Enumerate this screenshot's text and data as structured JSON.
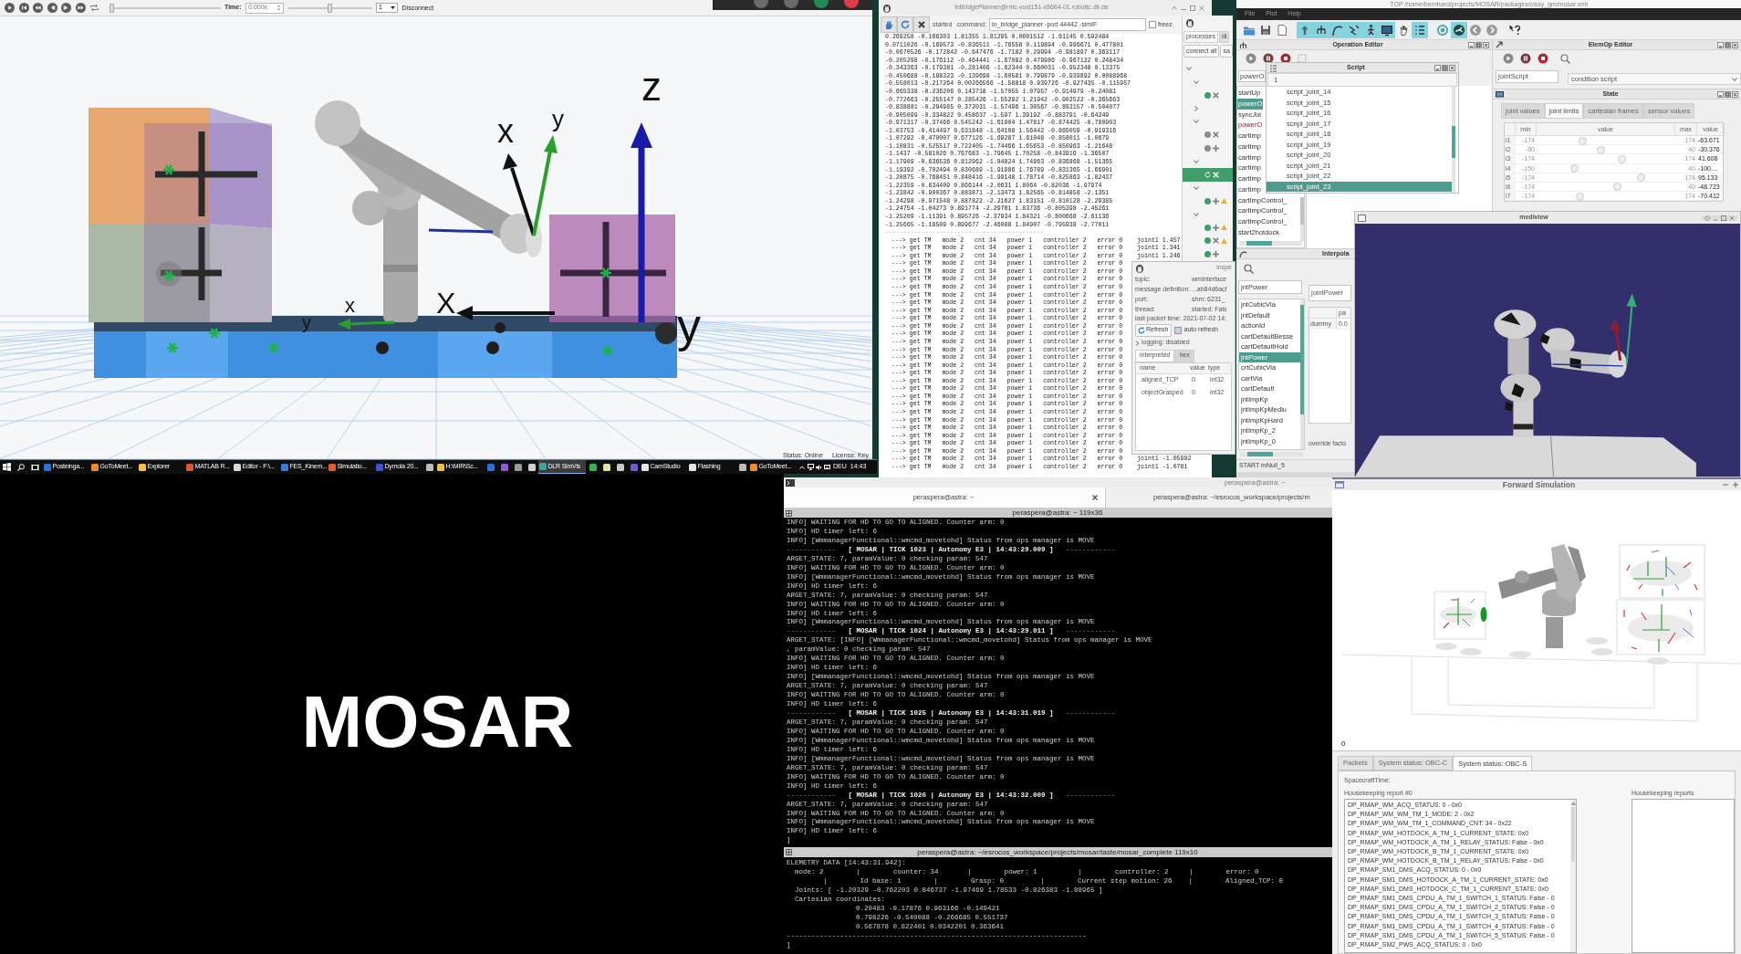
{
  "simvis": {
    "toolbar": {
      "position_slider": {
        "level": 0
      },
      "time_label": "Time:",
      "time_value": "0,000x",
      "rate_slider": {
        "level": 0.5
      },
      "speed": "1",
      "disconnect": "Disconnect"
    },
    "axis_labels": [
      "z",
      "y",
      "X",
      "x",
      "y",
      "x",
      "y"
    ],
    "status": "Status: Online",
    "license": "License: Key"
  },
  "taskbar": {
    "items": [
      {
        "label": "Posteinga...",
        "color": "#2b72d6",
        "selected": false
      },
      {
        "label": "GoToMeet...",
        "color": "#f08a24",
        "selected": false
      },
      {
        "label": "Explorer",
        "color": "#f2c23c",
        "selected": false
      },
      {
        "label": "MATLAB R...",
        "color": "#e0562a",
        "selected": false
      },
      {
        "label": "Editor - F:\\...",
        "color": "#d9d9d9",
        "selected": false
      },
      {
        "label": "FES_Kinem...",
        "color": "#3a7bd5",
        "selected": false
      },
      {
        "label": "Simulatio...",
        "color": "#e35d2b",
        "selected": false
      },
      {
        "label": "Dymola 20...",
        "color": "#3656d6",
        "selected": false
      },
      {
        "color": "#bdbdbd",
        "selected": false
      },
      {
        "label": "H:\\MIR\\Sc...",
        "color": "#f2c23c",
        "selected": false
      },
      {
        "color": "#2e6fd8",
        "selected": false
      },
      {
        "color": "#8b5bd8",
        "selected": false
      },
      {
        "color": "#9a9a9a",
        "selected": false
      },
      {
        "color": "#d0d0d0",
        "selected": false
      },
      {
        "label": "DLR SimVis",
        "color": "#39a3a0",
        "selected": true
      },
      {
        "color": "#36b24a",
        "selected": false
      },
      {
        "color": "#e3e3a5",
        "selected": false
      },
      {
        "color": "#c8c8c8",
        "selected": false
      },
      {
        "color": "#6c5bd6",
        "selected": false
      },
      {
        "label": "CamStudio",
        "color": "#e6e6e6",
        "selected": false
      },
      {
        "label": "Flashing",
        "color": "#e6e6e6",
        "selected": false
      },
      {
        "color": "#bcbcbc",
        "selected": false
      },
      {
        "label": "GoToMeet...",
        "color": "#f08a24",
        "selected": false
      }
    ],
    "language": "DEU",
    "clock": "14:43"
  },
  "title_card": {
    "text": "MOSAR"
  },
  "planner": {
    "title": "lnBridgePlanner@rmc-vosl151-x8664-01.robotic.dlr.de",
    "state": "started",
    "command_label": "command:",
    "command": "ln_bridge_planner -port 44442 -simIF",
    "freeze": {
      "label": "freez",
      "checked": false
    },
    "output": [
      "0.269258 -0.166303 1.81355 1.81295 0.0601512 -1.61145 0.592484",
      "0.0711026 -0.169573 -0.836511 -1.76558 0.119894 -0.996671 0.477801",
      "-0.0670526 -0.172842 -0.647476 -1.7182 0.29994 -0.981897 0.363117",
      "-0.205298 -0.176112 -0.464441 -1.67082 0.479986 -0.967122 0.248434",
      "-0.343363 -0.179381 -0.281406 -1.62344 0.660031 -0.952348 0.13375",
      "-0.450688 -0.198323 -0.139698 -1.60581 0.799879 -0.939892 0.0088968",
      "-0.558013 -0.217264 0.00266566 -1.58818 0.939726 -0.927435 -0.115957",
      "-0.665338 -0.236206 0.143718 -1.57055 1.07957 -0.914979 -0.24081",
      "-0.772663 -0.255147 0.285426 -1.55292 1.21942 -0.902522 -0.365663",
      "-0.838881 -0.294985 0.372031 -1.57496 1.30567 -0.893157 -0.504077",
      "-0.905099 -0.334822 0.458637 -1.597 1.39192 -0.883791 -0.64249",
      "-0.971317 -0.37466 0.545242 -1.61904 1.47817 -0.874425 -0.780903",
      "-1.03753 -0.414497 0.631848 -1.64108 1.56442 -0.865059 -0.919316",
      "-1.07292 -0.470007 0.677126 -1.69287 1.61048 -0.858011 -1.0679",
      "-1.10831 -0.525517 0.722405 -1.74466 1.65653 -0.850963 -1.21648",
      "-1.1437 -0.581026 0.767683 -1.79645 1.70258 -0.843916 -1.36507",
      "-1.17909 -0.636536 0.812962 -1.84824 1.74863 -0.836868 -1.51365",
      "-1.19392 -0.702494 0.830689 -1.91986 1.76789 -0.831365 -1.66901",
      "-1.20875 -0.768451 0.848416 -1.99148 1.78714 -0.825863 -1.82437",
      "-1.22359 -0.834409 0.866144 -2.0631 1.8064 -0.82036 -1.97974",
      "-1.23842 -0.900367 0.883871 -2.13473 1.82565 -0.814858 -2.1351",
      "-1.24298 -0.971548 0.887822 -2.21627 1.83151 -0.810128 -2.29385",
      "-1.24754 -1.04273 0.891774 -2.29781 1.83736 -0.805398 -2.45261",
      "-1.25209 -1.11391 0.895726 -2.37934 1.84321 -0.800668 -2.61136",
      "-1.25665 -1.18509 0.899677 -2.46088 1.84907 -0.795938 -2.77011"
    ],
    "separator": "--------------------------------------------",
    "get_tm_rows": [
      "---> get TM   mode 2   cnt 34   power 1   controller 2   error 0    joint1 1.457",
      "---> get TM   mode 2   cnt 34   power 1   controller 2   error 0    joint1 1.341",
      "---> get TM   mode 2   cnt 34   power 1   controller 2   error 0    joint1 1.246",
      "---> get TM   mode 2   cnt 34   power 1   controller 2   error 0",
      "---> get TM   mode 2   cnt 34   power 1   controller 2   error 0",
      "---> get TM   mode 2   cnt 34   power 1   controller 2   error 0",
      "---> get TM   mode 2   cnt 34   power 1   controller 2   error 0",
      "---> get TM   mode 2   cnt 34   power 1   controller 2   error 0",
      "---> get TM   mode 2   cnt 34   power 1   controller 2   error 0",
      "---> get TM   mode 2   cnt 34   power 1   controller 2   error 0",
      "---> get TM   mode 2   cnt 34   power 1   controller 2   error 0",
      "---> get TM   mode 2   cnt 34   power 1   controller 2   error 0",
      "---> get TM   mode 2   cnt 34   power 1   controller 2   error 0",
      "---> get TM   mode 2   cnt 34   power 1   controller 2   error 0",
      "---> get TM   mode 2   cnt 34   power 1   controller 2   error 0",
      "---> get TM   mode 2   cnt 34   power 1   controller 2   error 0",
      "---> get TM   mode 2   cnt 34   power 1   controller 2   error 0",
      "---> get TM   mode 2   cnt 34   power 1   controller 2   error 0",
      "---> get TM   mode 2   cnt 34   power 1   controller 2   error 0",
      "---> get TM   mode 2   cnt 34   power 1   controller 2   error 0",
      "---> get TM   mode 2   cnt 34   power 1   controller 2   error 0",
      "---> get TM   mode 2   cnt 34   power 1   controller 2   error 0",
      "---> get TM   mode 2   cnt 34   power 1   controller 2   error 0",
      "---> get TM   mode 2   cnt 34   power 1   controller 2   error 0",
      "---> get TM   mode 2   cnt 34   power 1   controller 2   error 0",
      "---> get TM   mode 2   cnt 34   power 1   controller 2   error 0",
      "---> get TM   mode 2   cnt 34   power 1   controller 2   error 0",
      "---> get TM   mode 2   cnt 34   power 1   controller 2   error 0",
      "---> get TM   mode 2   cnt 34   power 1   controller 2   error 0    joint1 -1.05992",
      "---> get TM   mode 2   cnt 34   power 1   controller 2   error 0    joint1 -1.0781"
    ],
    "processes": {
      "tabs": [
        {
          "label": "processes",
          "selected": true
        },
        {
          "label": "di",
          "selected": false
        }
      ],
      "buttons": [
        "connect all",
        "sa"
      ],
      "tree": [
        {
          "expanded": true,
          "selected": false,
          "children": [
            {
              "expanded": true,
              "selected": false,
              "children": [
                {
                  "kind": "cross",
                  "color": "#3f9d6b",
                  "warning": false,
                  "selected": false
                }
              ]
            },
            {
              "expanded": false,
              "selected": false
            },
            {
              "expanded": true,
              "selected": false,
              "children": [
                {
                  "kind": "cross",
                  "color": "#8c8c8c",
                  "warning": false,
                  "selected": false
                },
                {
                  "kind": "plus",
                  "color": "#8c8c8c",
                  "warning": false,
                  "selected": false
                }
              ]
            },
            {
              "expanded": true,
              "selected": false,
              "children": [
                {
                  "kind": "busy",
                  "warning": false,
                  "selected": true
                }
              ]
            },
            {
              "expanded": true,
              "selected": false,
              "children": [
                {
                  "kind": "plus",
                  "color": "#3f9d6b",
                  "warning": true,
                  "selected": false
                }
              ]
            },
            {
              "expanded": true,
              "selected": false,
              "children": [
                {
                  "kind": "plus",
                  "color": "#3f9d6b",
                  "warning": true,
                  "selected": false
                },
                {
                  "kind": "cross",
                  "color": "#3f9d6b",
                  "warning": true,
                  "selected": false
                },
                {
                  "kind": "plus",
                  "color": "#3f9d6b",
                  "warning": false,
                  "selected": false
                }
              ]
            }
          ]
        }
      ]
    },
    "inspector": {
      "title": "inspe",
      "fields": [
        {
          "label": "topic:",
          "value": "wmInterface"
        },
        {
          "label": "message definition:",
          "value": "...ab84d6acf"
        },
        {
          "label": "port:",
          "value": "shm: 6231_"
        },
        {
          "label": "thread:",
          "value": "started: Fals"
        }
      ],
      "last_packet": "last packet time: 2021-07-02 14:",
      "refresh": "Refresh",
      "auto_refresh": {
        "label": "auto refresh",
        "checked": false
      },
      "logging": {
        "label": "logging: disabled",
        "expanded": false
      },
      "tabs": [
        {
          "label": "interpreted",
          "selected": true
        },
        {
          "label": "hex",
          "selected": false
        }
      ],
      "columns": [
        "name",
        "value",
        "type"
      ],
      "rows": [
        [
          "aligned_TCP",
          "0",
          "int32"
        ],
        [
          "objectGrasped",
          "0",
          "int32"
        ]
      ]
    }
  },
  "editor": {
    "title": "TOP /home/bernhard/projects/MOSAR/packages/cissy_gm/mosar.xml",
    "menu": [
      "File",
      "Plot",
      "Help"
    ],
    "toolbar": [
      {
        "kind": "folder",
        "on": false
      },
      {
        "kind": "disk",
        "on": false
      },
      {
        "kind": "sheet",
        "on": false
      },
      {
        "kind": "arrow",
        "on": true
      },
      {
        "kind": "tree",
        "on": true
      },
      {
        "kind": "curve",
        "on": true
      },
      {
        "kind": "wave",
        "on": true
      },
      {
        "kind": "figure",
        "on": true
      },
      {
        "kind": "screen",
        "on": true
      },
      {
        "kind": "hand",
        "on": false
      },
      {
        "kind": "list",
        "on": true
      },
      {
        "kind": "ring",
        "on": false
      },
      {
        "kind": "gauge",
        "on": true
      },
      {
        "kind": "back",
        "on": false
      },
      {
        "kind": "forward",
        "on": false
      },
      {
        "kind": "help",
        "on": false
      }
    ],
    "operation_editor": {
      "title": "Operation Editor",
      "field": "powerO",
      "items": [
        {
          "label": "startUp",
          "selected": false,
          "kind": "plain"
        },
        {
          "label": "powerO",
          "selected": true,
          "kind": "plain"
        },
        {
          "label": "syncJoi",
          "selected": false,
          "kind": "plain"
        },
        {
          "label": "powerO",
          "selected": false,
          "kind": "alert"
        },
        {
          "label": "cartImp",
          "selected": false,
          "kind": "plain"
        },
        {
          "label": "cartImp",
          "selected": false,
          "kind": "plain"
        },
        {
          "label": "cartImp",
          "selected": false,
          "kind": "plain"
        },
        {
          "label": "cartImp",
          "selected": false,
          "kind": "plain"
        },
        {
          "label": "cartImp",
          "selected": false,
          "kind": "plain"
        },
        {
          "label": "cartImp",
          "selected": false,
          "kind": "plain"
        },
        {
          "label": "cartImpControl_",
          "selected": false,
          "kind": "plain"
        },
        {
          "label": "cartImpControl_",
          "selected": false,
          "kind": "plain"
        },
        {
          "label": "cartImpControl_",
          "selected": false,
          "kind": "plain"
        },
        {
          "label": "start2hotdock",
          "selected": false,
          "kind": "plain"
        }
      ]
    },
    "script": {
      "title": "Script",
      "field": "1",
      "items": [
        {
          "label": "script_joint_14",
          "selected": false
        },
        {
          "label": "script_joint_15",
          "selected": false
        },
        {
          "label": "script_joint_16",
          "selected": false
        },
        {
          "label": "script_joint_17",
          "selected": false
        },
        {
          "label": "script_joint_18",
          "selected": false
        },
        {
          "label": "script_joint_19",
          "selected": false
        },
        {
          "label": "script_joint_20",
          "selected": false
        },
        {
          "label": "script_joint_21",
          "selected": false
        },
        {
          "label": "script_joint_22",
          "selected": false
        },
        {
          "label": "script_joint_23",
          "selected": true
        }
      ]
    },
    "elemop_editor": {
      "title": "ElemOp Editor",
      "field": "jointScript",
      "dropdown": "condition script"
    },
    "state": {
      "title": "State",
      "tabs": [
        {
          "label": "joint values",
          "selected": false
        },
        {
          "label": "joint limits",
          "selected": true
        },
        {
          "label": "cartesian frames",
          "selected": false
        },
        {
          "label": "sensor values",
          "selected": false
        }
      ],
      "columns": [
        "min",
        "value",
        "max",
        "value"
      ],
      "rows": [
        {
          "label": "i1",
          "min": "-174",
          "level": 0.32,
          "max": "174",
          "value": "-63.671"
        },
        {
          "label": "i2",
          "min": "-90",
          "level": 0.46,
          "max": "40",
          "value": "-30.376"
        },
        {
          "label": "i3",
          "min": "-174",
          "level": 0.62,
          "max": "174",
          "value": "41.608"
        },
        {
          "label": "i4",
          "min": "-150",
          "level": 0.26,
          "max": "40",
          "value": "-100...."
        },
        {
          "label": "i5",
          "min": "-174",
          "level": 0.77,
          "max": "174",
          "value": "95.133"
        },
        {
          "label": "i6",
          "min": "-174",
          "level": 0.59,
          "max": "40",
          "value": "-48.723"
        },
        {
          "label": "i7",
          "min": "-174",
          "level": 0.3,
          "max": "174",
          "value": "-70.412"
        }
      ]
    },
    "interpolation": {
      "title": "Interpola",
      "field": "jntPower",
      "items": [
        {
          "label": "jntCubicVia",
          "selected": false
        },
        {
          "label": "jntDefault",
          "selected": false
        },
        {
          "label": "actionId",
          "selected": false
        },
        {
          "label": "cartDefaultBesse",
          "selected": false
        },
        {
          "label": "cartDefaultHold",
          "selected": false
        },
        {
          "label": "jntPower",
          "selected": true
        },
        {
          "label": "crtCubicVia",
          "selected": false
        },
        {
          "label": "cartVia",
          "selected": false
        },
        {
          "label": "cartDefault",
          "selected": false
        },
        {
          "label": "jntImpKp",
          "selected": false
        },
        {
          "label": "jntImpKpMediu",
          "selected": false
        },
        {
          "label": "jntImpKpHard",
          "selected": false
        },
        {
          "label": "jntImpKp_2",
          "selected": false
        },
        {
          "label": "jntImpKp_0",
          "selected": false
        }
      ],
      "name_field": "jointPower",
      "table_column": "pa",
      "table_row": [
        "dummy",
        "0.0"
      ],
      "override": "override facto",
      "status": "START mNull_5"
    },
    "mediview": {
      "title": "mediview"
    }
  },
  "terminal": {
    "window_title": "peraspera@astra: ~",
    "tabs": [
      {
        "label": "peraspera@astra: ~",
        "selected": true
      },
      {
        "label": "peraspera@astra: ~/esrocos_workspace/projects/m",
        "selected": false
      }
    ],
    "pane_title": "peraspera@astra: ~ 119x36",
    "lines": [
      {
        "kind": "info",
        "text": "INFO] WAITING FOR HD TO GO TO ALIGNED. Counter arm: 0"
      },
      {
        "kind": "info",
        "text": "INFO] HD timer left: 6"
      },
      {
        "kind": "info",
        "text": "INFO] [WmmanagerFunctional::wmcmd_movetohd] Status from ops manager is MOVE"
      },
      {
        "kind": "tick",
        "text": "------------   **[ MOSAR | TICK 1023 | Autonomy E3 | 14:43:29.009 ]**   ------------"
      },
      {
        "kind": "info",
        "text": "ARGET_STATE: 7, paramValue: 0 checking param: 547"
      },
      {
        "kind": "info",
        "text": "INFO] WAITING FOR HD TO GO TO ALIGNED. Counter arm: 0"
      },
      {
        "kind": "info",
        "text": "INFO] [WmmanagerFunctional::wmcmd_movetohd] Status from ops manager is MOVE"
      },
      {
        "kind": "info",
        "text": "INFO] HD timer left: 6"
      },
      {
        "kind": "info",
        "text": "ARGET_STATE: 7, paramValue: 0 checking param: 547"
      },
      {
        "kind": "info",
        "text": "INFO] WAITING FOR HD TO GO TO ALIGNED. Counter arm: 0"
      },
      {
        "kind": "info",
        "text": "INFO] HD timer left: 6"
      },
      {
        "kind": "info",
        "text": "INFO] [WmmanagerFunctional::wmcmd_movetohd] Status from ops manager is MOVE"
      },
      {
        "kind": "tick",
        "text": "------------   **[ MOSAR | TICK 1024 | Autonomy E3 | 14:43:29.011 ]**   ------------"
      },
      {
        "kind": "info",
        "text": "ARGET_STATE: [INFO] [WmmanagerFunctional::wmcmd_movetohd] Status from ops manager is MOVE"
      },
      {
        "kind": "info",
        "text": ", paramValue: 0 checking param: 547"
      },
      {
        "kind": "info",
        "text": "INFO] WAITING FOR HD TO GO TO ALIGNED. Counter arm: 0"
      },
      {
        "kind": "info",
        "text": "INFO] HD timer left: 6"
      },
      {
        "kind": "info",
        "text": "INFO] [WmmanagerFunctional::wmcmd_movetohd] Status from ops manager is MOVE"
      },
      {
        "kind": "info",
        "text": "ARGET_STATE: 7, paramValue: 0 checking param: 547"
      },
      {
        "kind": "info",
        "text": "INFO] WAITING FOR HD TO GO TO ALIGNED. Counter arm: 0"
      },
      {
        "kind": "info",
        "text": "INFO] HD timer left: 6"
      },
      {
        "kind": "tick",
        "text": "------------   **[ MOSAR | TICK 1025 | Autonomy E3 | 14:43:31.019 ]**   ------------"
      },
      {
        "kind": "info",
        "text": "ARGET_STATE: 7, paramValue: 0 checking param: 547"
      },
      {
        "kind": "info",
        "text": "INFO] WAITING FOR HD TO GO TO ALIGNED. Counter arm: 0"
      },
      {
        "kind": "info",
        "text": "INFO] [WmmanagerFunctional::wmcmd_movetohd] Status from ops manager is MOVE"
      },
      {
        "kind": "info",
        "text": "INFO] HD timer left: 6"
      },
      {
        "kind": "info",
        "text": "INFO] [WmmanagerFunctional::wmcmd_movetohd] Status from ops manager is MOVE"
      },
      {
        "kind": "info",
        "text": "ARGET_STATE: 7, paramValue: 0 checking param: 547"
      },
      {
        "kind": "info",
        "text": "INFO] WAITING FOR HD TO GO TO ALIGNED. Counter arm: 0"
      },
      {
        "kind": "info",
        "text": "INFO] HD timer left: 6"
      },
      {
        "kind": "tick",
        "text": "------------   **[ MOSAR | TICK 1026 | Autonomy E3 | 14:43:32.009 ]**   ------------"
      },
      {
        "kind": "info",
        "text": "ARGET_STATE: 7, paramValue: 0 checking param: 547"
      },
      {
        "kind": "info",
        "text": "INFO] WAITING FOR HD TO GO TO ALIGNED. Counter arm: 0"
      },
      {
        "kind": "info",
        "text": "INFO] [WmmanagerFunctional::wmcmd_movetohd] Status from ops manager is MOVE"
      },
      {
        "kind": "info",
        "text": "INFO] HD timer left: 6"
      },
      {
        "kind": "info",
        "text": "]"
      }
    ],
    "telemetry_title": "peraspera@astra: ~/esrocos_workspace/projects/mosar/taste/mosar_complete 119x10",
    "telemetry": [
      "ELEMETRY DATA [14:43:31.942]:",
      "mode: 2        |        counter: 34       |        power: 1          |        controller: 2     |        error: 0",
      "|        Id base: 1        |        Grasp: 0         |        Current step motion: 26    |        Aligned_TCP: 0",
      "Joints: [ -1.20329 -0.762203 0.846737 -1.97469 1.78533 -0.826383 -1.88965 ]",
      "Cartesian coordinates:",
      "0.20483 -0.17876 0.963166 -0.149421",
      "0.798226 -0.540088 -0.266685 0.551737",
      "0.567878 0.822401 0.0342201 0.363641",
      "-------------------------------------------------------------------------",
      "]"
    ]
  },
  "forward_sim": {
    "title": "Forward Simulation",
    "frame_counter": "0",
    "tabs": [
      {
        "label": "Packets",
        "selected": false
      },
      {
        "label": "System status: OBC-C",
        "selected": false
      },
      {
        "label": "System status: OBC-S",
        "selected": true
      }
    ],
    "spacecraft_time": "SpacecraftTime:",
    "report_title": "Housekeeping report #0",
    "report_items": [
      "DP_RMAP_WM_ACQ_STATUS: 0 - 0x0",
      "DP_RMAP_WM_WM_TM_1_MODE: 2 - 0x2",
      "DP_RMAP_WM_WM_TM_1_COMMAND_CNT: 34 - 0x22",
      "DP_RMAP_WM_HOTDOCK_A_TM_1_CURRENT_STATE: 0x0",
      "DP_RMAP_WM_HOTDOCK_A_TM_1_RELAY_STATUS: False - 0x0",
      "DP_RMAP_WM_HOTDOCK_B_TM_1_CURRENT_STATE: 0x0",
      "DP_RMAP_WM_HOTDOCK_B_TM_1_RELAY_STATUS: False - 0x0",
      "DP_RMAP_SM1_DMS_ACQ_STATUS: 0 - 0x0",
      "DP_RMAP_SM1_DMS_HOTDOCK_A_TM_1_CURRENT_STATE: 0x0",
      "DP_RMAP_SM1_DMS_HOTDOCK_C_TM_1_CURRENT_STATE: 0x0",
      "DP_RMAP_SM1_DMS_CPDU_A_TM_1_SWITCH_1_STATUS: False - 0",
      "DP_RMAP_SM1_DMS_CPDU_A_TM_1_SWITCH_2_STATUS: False - 0",
      "DP_RMAP_SM1_DMS_CPDU_A_TM_1_SWITCH_3_STATUS: False - 0",
      "DP_RMAP_SM1_DMS_CPDU_A_TM_1_SWITCH_4_STATUS: False - 0",
      "DP_RMAP_SM1_DMS_CPDU_A_TM_1_SWITCH_5_STATUS: False - 0",
      "DP_RMAP_SM2_PWS_ACQ_STATUS: 0 - 0x0"
    ],
    "reports_title": "Housekeeping reports"
  }
}
